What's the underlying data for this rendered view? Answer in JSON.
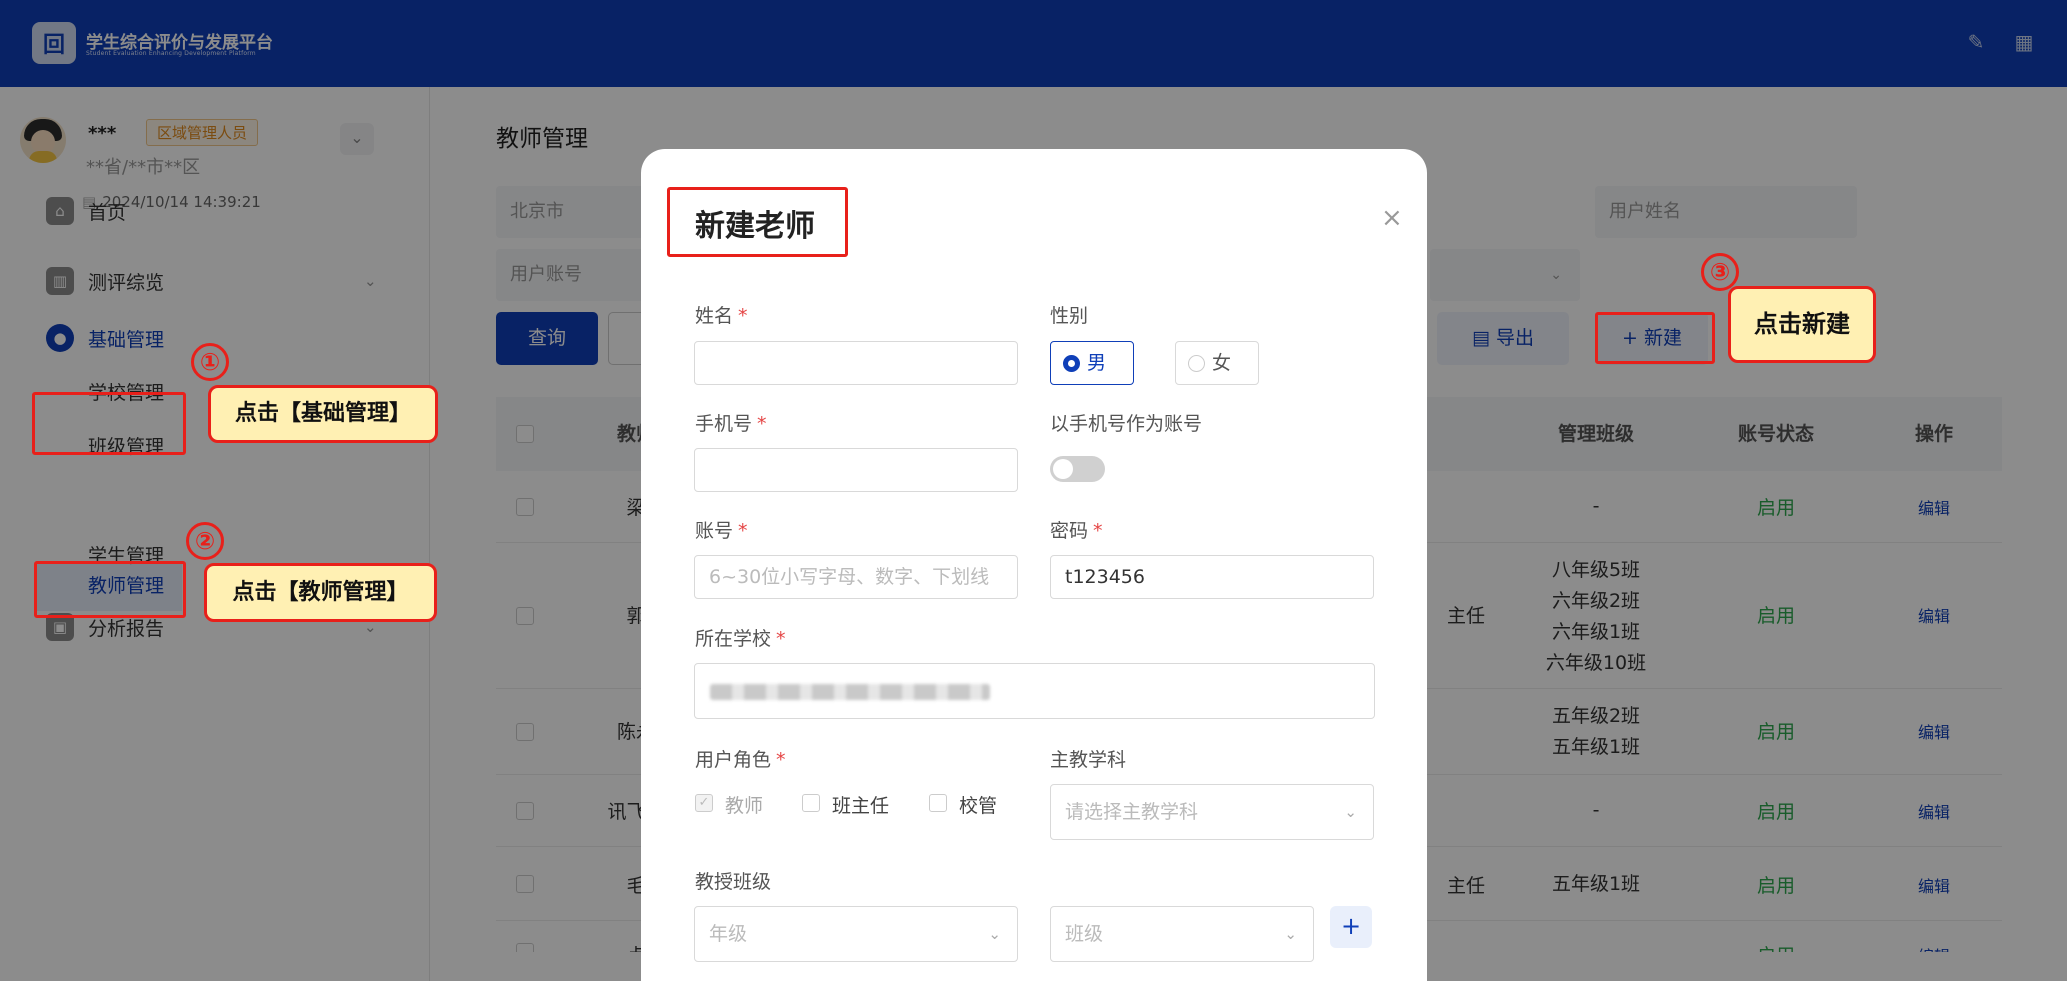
{
  "header": {
    "title": "学生综合评价与发展平台",
    "subtitle": "Student Evaluation Enhancing Development Platform",
    "icons": [
      "edit-icon",
      "qrcode-icon"
    ]
  },
  "user": {
    "name": "***",
    "role": "区域管理人员",
    "area": "**省/**市**区",
    "time": "2024/10/14 14:39:21"
  },
  "sidebar": {
    "items": [
      {
        "label": "首页",
        "icon": "home-icon"
      },
      {
        "label": "测评综览",
        "icon": "chart-icon"
      },
      {
        "label": "基础管理",
        "icon": "user-settings-icon"
      },
      {
        "label": "分析报告",
        "icon": "clipboard-icon"
      }
    ],
    "sub_items": [
      "学校管理",
      "班级管理",
      "教师管理",
      "学生管理"
    ]
  },
  "main": {
    "title": "教师管理",
    "filter_city": "北京市",
    "filter_name_placeholder": "用户姓名",
    "filter_account_placeholder": "用户账号",
    "query_label": "查询",
    "export_label": "导出",
    "new_label": "新建",
    "table": {
      "headers": [
        "教师",
        "管理班级",
        "账号状态",
        "操作"
      ],
      "rows": [
        {
          "name": "梁",
          "role": "",
          "classes": [
            "-"
          ],
          "status": "启用",
          "op": "编辑"
        },
        {
          "name": "郭",
          "role": "主任",
          "classes": [
            "八年级5班",
            "六年级2班",
            "六年级1班",
            "六年级10班"
          ],
          "status": "启用",
          "op": "编辑"
        },
        {
          "name": "陈永",
          "role": "",
          "classes": [
            "五年级2班",
            "五年级1班"
          ],
          "status": "启用",
          "op": "编辑"
        },
        {
          "name": "讯飞学",
          "role": "",
          "classes": [
            "-"
          ],
          "status": "启用",
          "op": "编辑"
        },
        {
          "name": "毛",
          "role": "主任",
          "classes": [
            "五年级1班"
          ],
          "status": "启用",
          "op": "编辑"
        },
        {
          "name": "卢",
          "role": "",
          "classes": [
            ""
          ],
          "status": "启用",
          "op": "编辑"
        }
      ]
    }
  },
  "modal": {
    "title": "新建老师",
    "labels": {
      "name": "姓名",
      "gender": "性别",
      "phone": "手机号",
      "phone_as_account": "以手机号作为账号",
      "account": "账号",
      "password": "密码",
      "school": "所在学校",
      "role": "用户角色",
      "subject": "主教学科",
      "classes": "教授班级"
    },
    "gender_male": "男",
    "gender_female": "女",
    "account_placeholder": "6~30位小写字母、数字、下划线",
    "password_value": "t123456",
    "role_teacher": "教师",
    "role_head": "班主任",
    "role_admin": "校管",
    "subject_placeholder": "请选择主教学科",
    "grade_placeholder": "年级",
    "class_placeholder": "班级",
    "required_mark": "*"
  },
  "annotations": {
    "step1_num": "①",
    "step1": "点击【基础管理】",
    "step2_num": "②",
    "step2": "点击【教师管理】",
    "step3_num": "③",
    "step3": "点击新建"
  },
  "colors": {
    "brand": "#0f3fb8",
    "annotation_red": "#e8201a",
    "callout_bg": "#fff0b3",
    "status_green": "#2fa84f"
  }
}
